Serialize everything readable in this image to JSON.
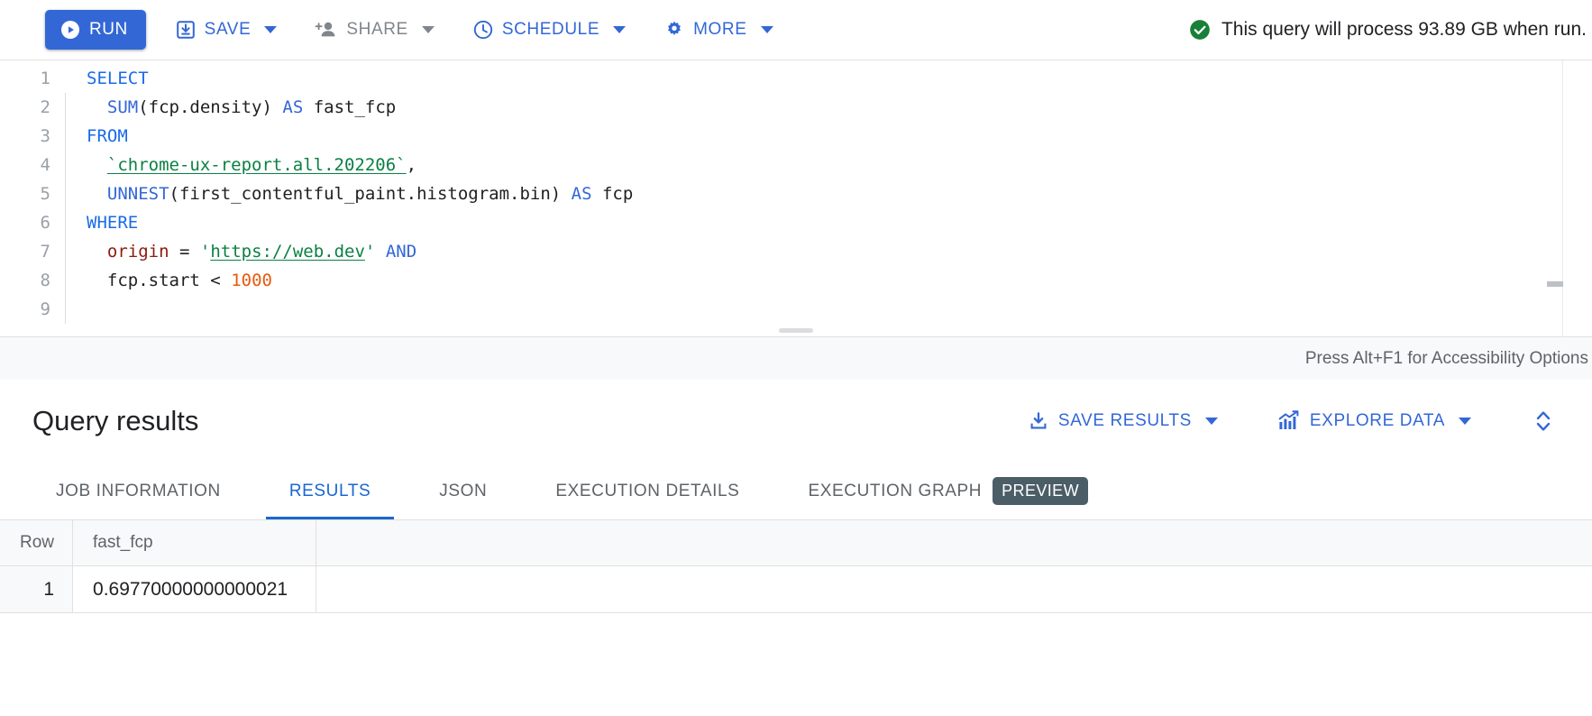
{
  "toolbar": {
    "run": {
      "label": "RUN",
      "icon": "play-circle-icon"
    },
    "save": {
      "label": "SAVE",
      "icon": "save-icon",
      "has_dropdown": true
    },
    "share": {
      "label": "SHARE",
      "icon": "person-add-icon",
      "has_dropdown": true,
      "disabled": true
    },
    "schedule": {
      "label": "SCHEDULE",
      "icon": "clock-icon",
      "has_dropdown": true
    },
    "more": {
      "label": "MORE",
      "icon": "gear-icon",
      "has_dropdown": true
    },
    "status": {
      "icon": "check-circle-icon",
      "text": "This query will process 93.89 GB when run.",
      "color": "#188038"
    },
    "accent_color": "#3367d6",
    "disabled_color": "#80868b"
  },
  "editor": {
    "line_numbers": [
      "1",
      "2",
      "3",
      "4",
      "5",
      "6",
      "7",
      "8",
      "9"
    ],
    "lines": [
      {
        "n": "1",
        "tokens": [
          {
            "t": "SELECT",
            "c": "kw"
          }
        ]
      },
      {
        "n": "2",
        "tokens": [
          {
            "t": "  ",
            "c": "plain"
          },
          {
            "t": "SUM",
            "c": "kw2"
          },
          {
            "t": "(fcp.density) ",
            "c": "plain"
          },
          {
            "t": "AS",
            "c": "kw2"
          },
          {
            "t": " fast_fcp",
            "c": "plain"
          }
        ]
      },
      {
        "n": "3",
        "tokens": [
          {
            "t": "FROM",
            "c": "kw"
          }
        ]
      },
      {
        "n": "4",
        "tokens": [
          {
            "t": "  ",
            "c": "plain"
          },
          {
            "t": "`chrome-ux-report.all.202206`",
            "c": "str"
          },
          {
            "t": ",",
            "c": "plain"
          }
        ]
      },
      {
        "n": "5",
        "tokens": [
          {
            "t": "  ",
            "c": "plain"
          },
          {
            "t": "UNNEST",
            "c": "kw2"
          },
          {
            "t": "(first_contentful_paint.histogram.bin) ",
            "c": "plain"
          },
          {
            "t": "AS",
            "c": "kw2"
          },
          {
            "t": " fcp",
            "c": "plain"
          }
        ]
      },
      {
        "n": "6",
        "tokens": [
          {
            "t": "WHERE",
            "c": "kw"
          }
        ]
      },
      {
        "n": "7",
        "tokens": [
          {
            "t": "  ",
            "c": "plain"
          },
          {
            "t": "origin",
            "c": "fld"
          },
          {
            "t": " = ",
            "c": "plain"
          },
          {
            "t": "'",
            "c": "strq"
          },
          {
            "t": "https://web.dev",
            "c": "str"
          },
          {
            "t": "'",
            "c": "strq"
          },
          {
            "t": " ",
            "c": "plain"
          },
          {
            "t": "AND",
            "c": "kw2"
          }
        ]
      },
      {
        "n": "8",
        "tokens": [
          {
            "t": "  ",
            "c": "plain"
          },
          {
            "t": "fcp.start ",
            "c": "plain"
          },
          {
            "t": "<",
            "c": "plain"
          },
          {
            "t": " ",
            "c": "plain"
          },
          {
            "t": "1000",
            "c": "num"
          }
        ]
      },
      {
        "n": "9",
        "tokens": []
      }
    ],
    "footer_text": "Press Alt+F1 for Accessibility Options",
    "colors": {
      "keyword": "#1a6ae8",
      "string": "#0b8043",
      "field": "#8c1a11",
      "number": "#e8590c",
      "plain": "#202124",
      "line_number": "#9aa0a6"
    }
  },
  "results": {
    "title": "Query results",
    "save_results": {
      "label": "SAVE RESULTS",
      "icon": "download-icon",
      "has_dropdown": true
    },
    "explore_data": {
      "label": "EXPLORE DATA",
      "icon": "chart-icon",
      "has_dropdown": true
    },
    "expand_toggle": {
      "icon": "unfold-more-icon"
    },
    "tabs": [
      {
        "label": "JOB INFORMATION",
        "active": false,
        "badge": null
      },
      {
        "label": "RESULTS",
        "active": true,
        "badge": null
      },
      {
        "label": "JSON",
        "active": false,
        "badge": null
      },
      {
        "label": "EXECUTION DETAILS",
        "active": false,
        "badge": null
      },
      {
        "label": "EXECUTION GRAPH",
        "active": false,
        "badge": "PREVIEW"
      }
    ],
    "table": {
      "columns": [
        "Row",
        "fast_fcp"
      ],
      "rows": [
        {
          "row": "1",
          "fast_fcp": "0.69770000000000021"
        }
      ]
    }
  }
}
